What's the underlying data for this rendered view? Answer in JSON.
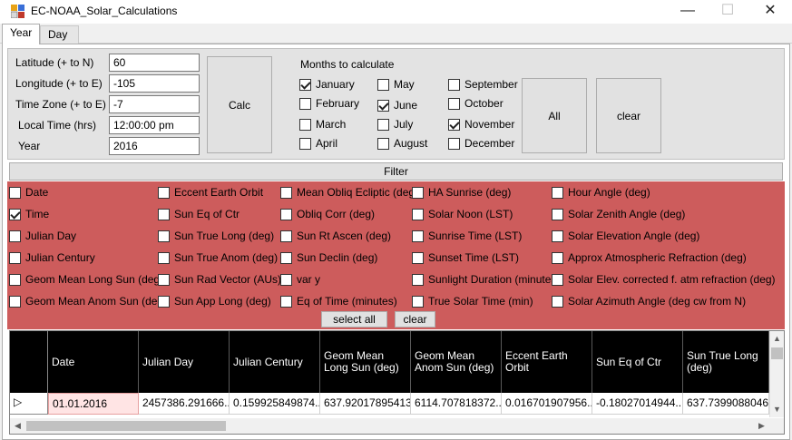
{
  "window": {
    "title": "EC-NOAA_Solar_Calculations",
    "minimize_glyph": "—",
    "maximize_glyph": "☐",
    "close_glyph": "✕"
  },
  "tabs": [
    {
      "label": "Year",
      "active": true
    },
    {
      "label": "Day",
      "active": false
    }
  ],
  "params": {
    "latitude_label": "Latitude (+ to N)",
    "latitude_value": "60",
    "longitude_label": "Longitude (+ to E)",
    "longitude_value": "-105",
    "timezone_label": "Time Zone (+ to E)",
    "timezone_value": "-7",
    "localtime_label": "Local Time (hrs)",
    "localtime_value": "12:00:00 pm",
    "year_label": "Year",
    "year_value": "2016",
    "calc_label": "Calc"
  },
  "months": {
    "title": "Months to calculate",
    "items": [
      {
        "label": "January",
        "checked": true
      },
      {
        "label": "February",
        "checked": false
      },
      {
        "label": "March",
        "checked": false
      },
      {
        "label": "April",
        "checked": false
      },
      {
        "label": "May",
        "checked": false
      },
      {
        "label": "June",
        "checked": true
      },
      {
        "label": "July",
        "checked": false
      },
      {
        "label": "August",
        "checked": false
      },
      {
        "label": "September",
        "checked": false
      },
      {
        "label": "October",
        "checked": false
      },
      {
        "label": "November",
        "checked": true
      },
      {
        "label": "December",
        "checked": false
      }
    ],
    "all_label": "All",
    "clear_label": "clear"
  },
  "filter": {
    "title": "Filter",
    "panel_color": "#cd5c5c",
    "columns": [
      [
        {
          "label": "Date",
          "checked": false
        },
        {
          "label": "Time",
          "checked": true
        },
        {
          "label": "Julian Day",
          "checked": false
        },
        {
          "label": "Julian Century",
          "checked": false
        },
        {
          "label": "Geom Mean Long Sun (deg)",
          "checked": false
        },
        {
          "label": "Geom Mean Anom Sun (deg)",
          "checked": false
        }
      ],
      [
        {
          "label": "Eccent Earth Orbit",
          "checked": false
        },
        {
          "label": "Sun Eq of Ctr",
          "checked": false
        },
        {
          "label": "Sun True Long (deg)",
          "checked": false
        },
        {
          "label": "Sun True Anom (deg)",
          "checked": false
        },
        {
          "label": "Sun Rad Vector (AUs)",
          "checked": false
        },
        {
          "label": "Sun App Long (deg)",
          "checked": false
        }
      ],
      [
        {
          "label": "Mean Obliq Ecliptic (deg)",
          "checked": false
        },
        {
          "label": "Obliq Corr (deg)",
          "checked": false
        },
        {
          "label": "Sun Rt Ascen (deg)",
          "checked": false
        },
        {
          "label": "Sun Declin (deg)",
          "checked": false
        },
        {
          "label": "var y",
          "checked": false
        },
        {
          "label": "Eq of Time (minutes)",
          "checked": false
        }
      ],
      [
        {
          "label": "HA Sunrise (deg)",
          "checked": false
        },
        {
          "label": "Solar Noon (LST)",
          "checked": false
        },
        {
          "label": "Sunrise Time (LST)",
          "checked": false
        },
        {
          "label": "Sunset Time (LST)",
          "checked": false
        },
        {
          "label": "Sunlight Duration (minutes)",
          "checked": false
        },
        {
          "label": "True Solar Time (min)",
          "checked": false
        }
      ],
      [
        {
          "label": "Hour Angle (deg)",
          "checked": false
        },
        {
          "label": "Solar Zenith Angle (deg)",
          "checked": false
        },
        {
          "label": "Solar Elevation Angle (deg)",
          "checked": false
        },
        {
          "label": "Approx Atmospheric Refraction (deg)",
          "checked": false
        },
        {
          "label": "Solar Elev. corrected f. atm refraction (deg)",
          "checked": false
        },
        {
          "label": "Solar Azimuth Angle (deg cw from N)",
          "checked": false
        }
      ]
    ],
    "select_all_label": "select all",
    "clear_label": "clear"
  },
  "grid": {
    "row_indicator": "▷",
    "headers": [
      "Date",
      "Julian Day",
      "Julian Century",
      "Geom Mean Long Sun (deg)",
      "Geom Mean Anom Sun (deg)",
      "Eccent Earth Orbit",
      "Sun Eq of Ctr",
      "Sun True Long (deg)"
    ],
    "rows": [
      [
        "01.01.2016",
        "2457386.291666...",
        "0.159925849874...",
        "637.92017895413",
        "6114.707818372...",
        "0.016701907956...",
        "-0.18027014944...",
        "637.7399088046..."
      ]
    ],
    "scroll_up": "▲",
    "scroll_down": "▼",
    "scroll_left": "◀",
    "scroll_right": "▶"
  }
}
